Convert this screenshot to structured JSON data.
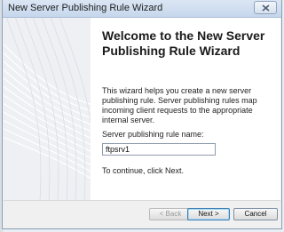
{
  "window": {
    "title": "New Server Publishing Rule Wizard"
  },
  "wizard": {
    "heading": "Welcome to the New Server Publishing Rule Wizard",
    "description": "This wizard helps you create a new server publishing rule. Server publishing rules map incoming client requests to the appropriate internal server.",
    "field_label": "Server publishing rule name:",
    "rule_name_value": "ftpsrv1",
    "continue_text": "To continue, click Next."
  },
  "buttons": {
    "back": "< Back",
    "next": "Next >",
    "cancel": "Cancel"
  },
  "icons": {
    "close": "close-icon",
    "graphic": "wizard-swirl-graphic"
  },
  "colors": {
    "titlebar": "#c6d7ec",
    "content_bg": "#ffffff",
    "panel_bg": "#f0f0f0"
  }
}
